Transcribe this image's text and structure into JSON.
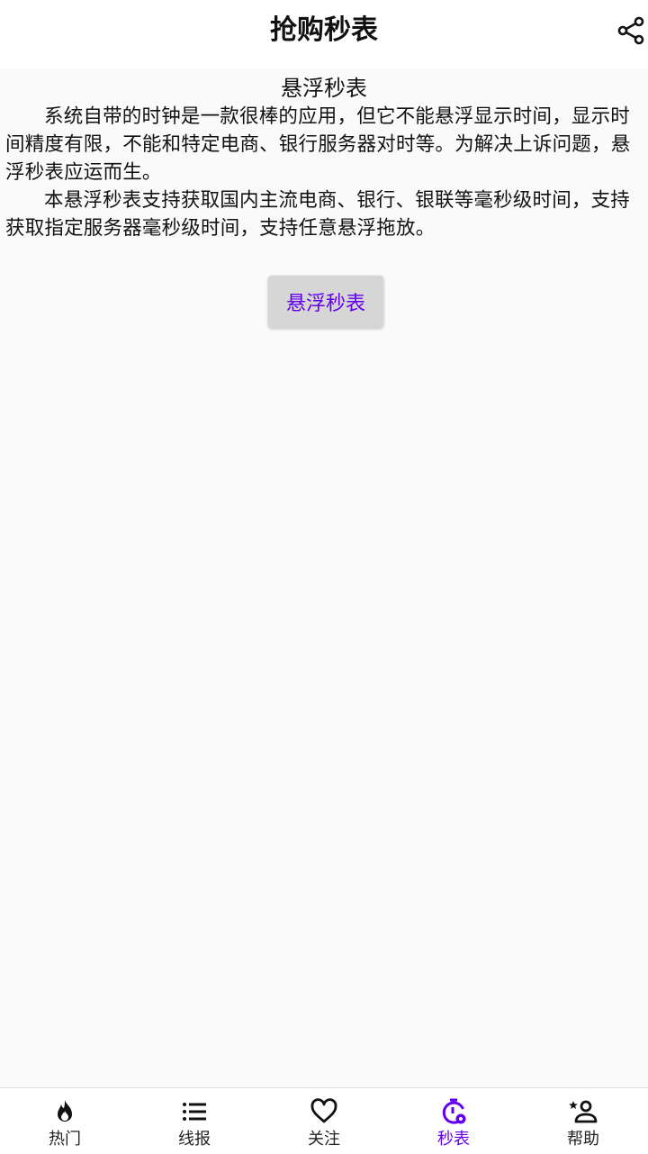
{
  "app": {
    "title": "抢购秒表"
  },
  "colors": {
    "accent": "#6200ee",
    "background": "#fafafa",
    "button_bg": "#d6d6d6"
  },
  "content": {
    "section_title": "悬浮秒表",
    "paragraphs": [
      "系统自带的时钟是一款很棒的应用，但它不能悬浮显示时间，显示时间精度有限，不能和特定电商、银行服务器对时等。为解决上诉问题，悬浮秒表应运而生。",
      "本悬浮秒表支持获取国内主流电商、银行、银联等毫秒级时间，支持获取指定服务器毫秒级时间，支持任意悬浮拖放。"
    ],
    "float_button_label": "悬浮秒表"
  },
  "bottom_nav": {
    "items": [
      {
        "label": "热门",
        "icon": "flame-icon",
        "active": false
      },
      {
        "label": "线报",
        "icon": "list-icon",
        "active": false
      },
      {
        "label": "关注",
        "icon": "heart-icon",
        "active": false
      },
      {
        "label": "秒表",
        "icon": "stopwatch-icon",
        "active": true
      },
      {
        "label": "帮助",
        "icon": "person-star-icon",
        "active": false
      }
    ]
  }
}
